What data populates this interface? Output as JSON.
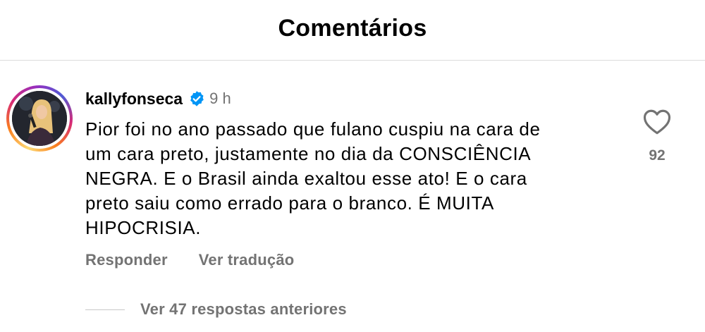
{
  "header": {
    "title": "Comentários"
  },
  "comment": {
    "username": "kallyfonseca",
    "verified_icon": "verified-badge-icon",
    "time": "9 h",
    "text": "Pior foi no ano passado que fulano cuspiu na cara de\num cara preto, justamente no dia da CONSCIÊNCIA\nNEGRA. E o Brasil ainda exaltou esse ato! E o cara\npreto saiu como errado para o branco. É MUITA\nHIPOCRISIA.",
    "actions": {
      "reply": "Responder",
      "translate": "Ver tradução"
    },
    "likes": "92",
    "like_icon": "heart-outline-icon",
    "replies_label": "Ver 47 respostas anteriores"
  },
  "colors": {
    "secondary_text": "#737373",
    "verified_blue": "#0095f6",
    "divider": "#dbdbdb"
  }
}
